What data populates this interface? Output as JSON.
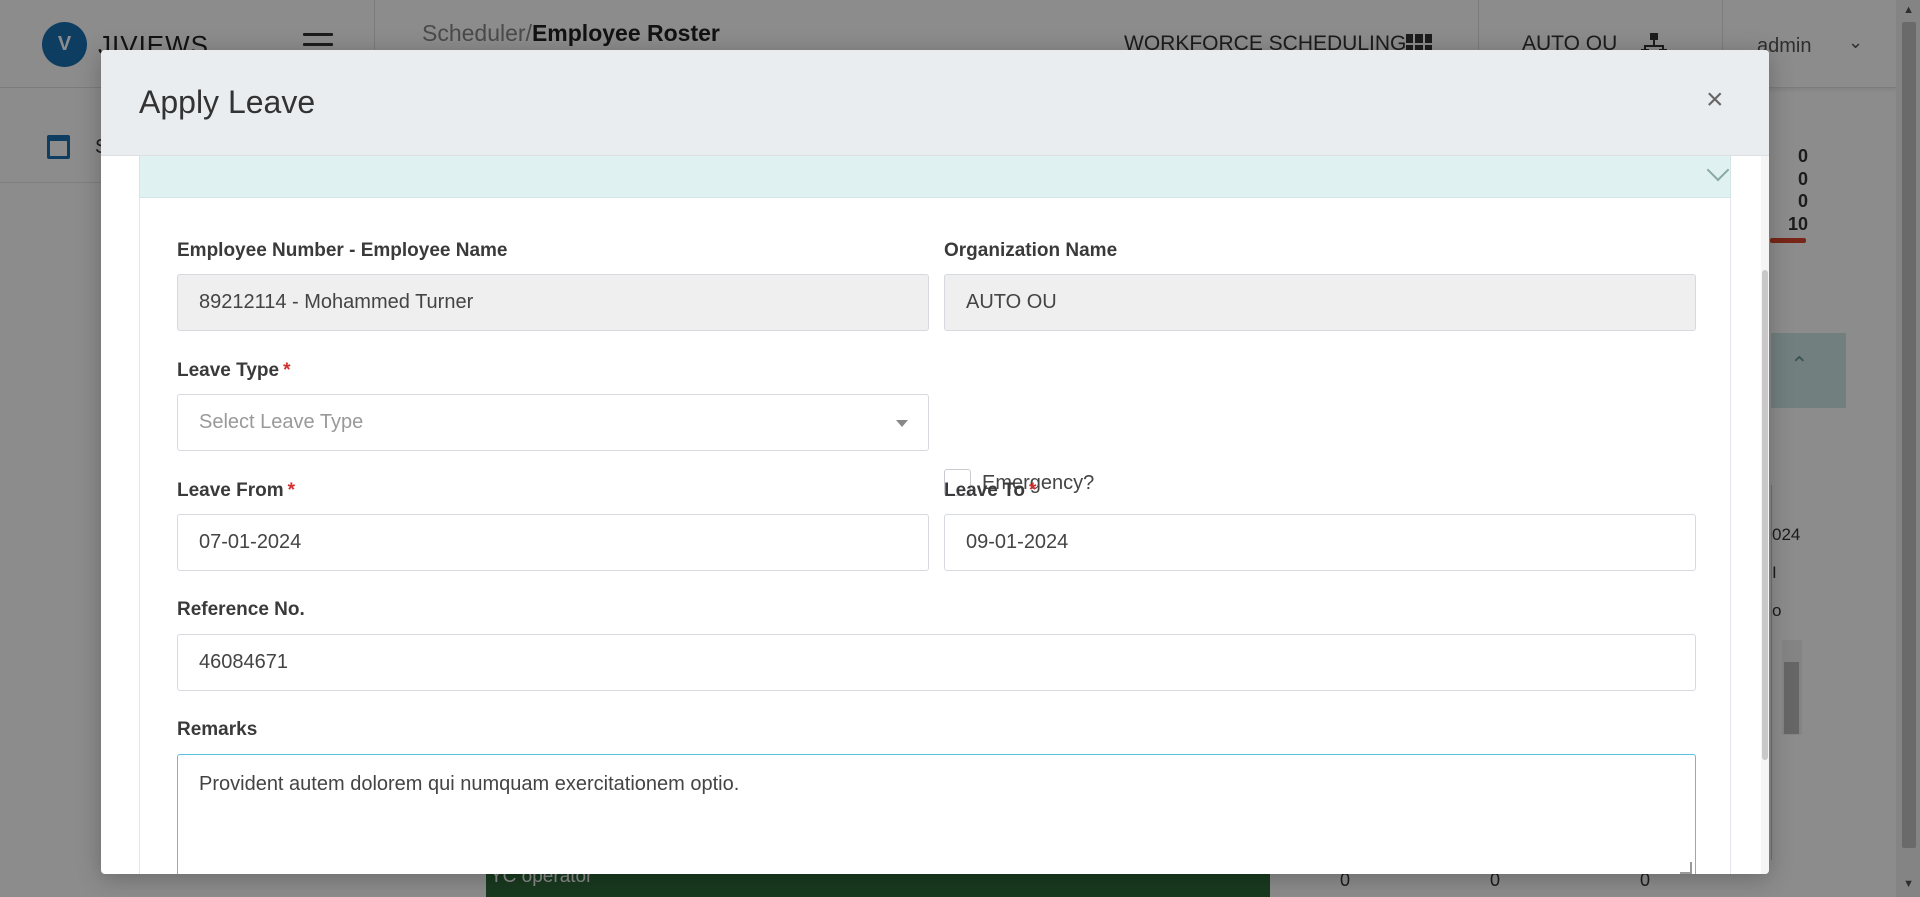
{
  "app": {
    "logo_letter": "V",
    "logo_name": "JIVIEWS",
    "breadcrumb_parent": "Scheduler/",
    "breadcrumb_current": "Employee Roster",
    "module_label": "WORKFORCE SCHEDULING",
    "ou_label": "AUTO OU",
    "user_label": "admin",
    "sidebar_label": "S"
  },
  "background": {
    "counts": [
      "0",
      "0",
      "0",
      "10"
    ],
    "table_cells": [
      "024",
      "I",
      "o"
    ],
    "role_label": "YC operator",
    "bottom_values": [
      "0",
      "0",
      "0"
    ]
  },
  "modal": {
    "title": "Apply Leave",
    "close_symbol": "×",
    "fields": {
      "employee_label": "Employee Number - Employee Name",
      "employee_value": "89212114 - Mohammed Turner",
      "org_label": "Organization Name",
      "org_value": "AUTO OU",
      "leave_type_label": "Leave Type",
      "leave_type_placeholder": "Select Leave Type",
      "emergency_label": "Emergency?",
      "emergency_checked": false,
      "leave_from_label": "Leave From",
      "leave_from_value": "07-01-2024",
      "leave_to_label": "Leave To",
      "leave_to_value": "09-01-2024",
      "reference_label": "Reference No.",
      "reference_value": "46084671",
      "remarks_label": "Remarks",
      "remarks_value": "Provident autem dolorem qui numquam exercitationem optio.",
      "required_marker": "*"
    }
  },
  "colors": {
    "brand": "#1b6fb3",
    "required": "#d32f2f",
    "accordion": "#dff2f1",
    "focus_border": "#5bc0de"
  }
}
